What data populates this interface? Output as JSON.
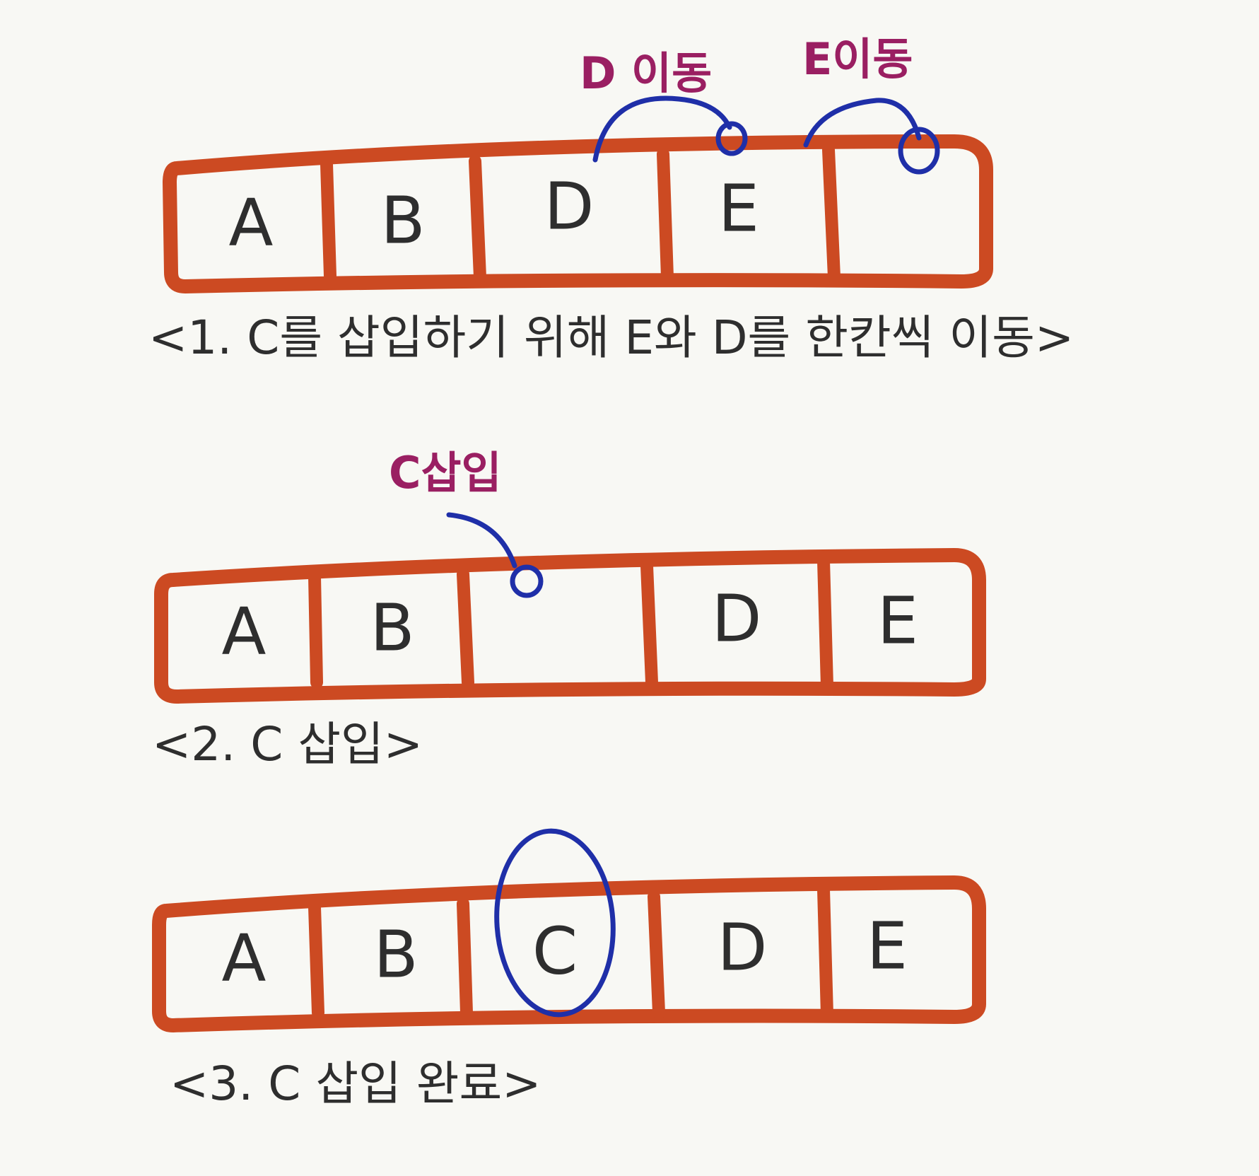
{
  "steps": [
    {
      "cells": [
        "A",
        "B",
        "D",
        "E",
        ""
      ],
      "notes": [
        "D 이동",
        "E이동"
      ],
      "caption": "<1. C를 삽입하기 위해 E와 D를 한칸씩 이동>"
    },
    {
      "cells": [
        "A",
        "B",
        "",
        "D",
        "E"
      ],
      "notes": [
        "C삽입"
      ],
      "caption": "<2. C 삽입>"
    },
    {
      "cells": [
        "A",
        "B",
        "C",
        "D",
        "E"
      ],
      "notes": [],
      "caption": "<3. C 삽입 완료>"
    }
  ],
  "colors": {
    "background": "#f8f8f4",
    "box": "#cc4a22",
    "letters": "#2e2e2e",
    "arrows": "#1f2fa8",
    "notes": "#9a1f62"
  }
}
